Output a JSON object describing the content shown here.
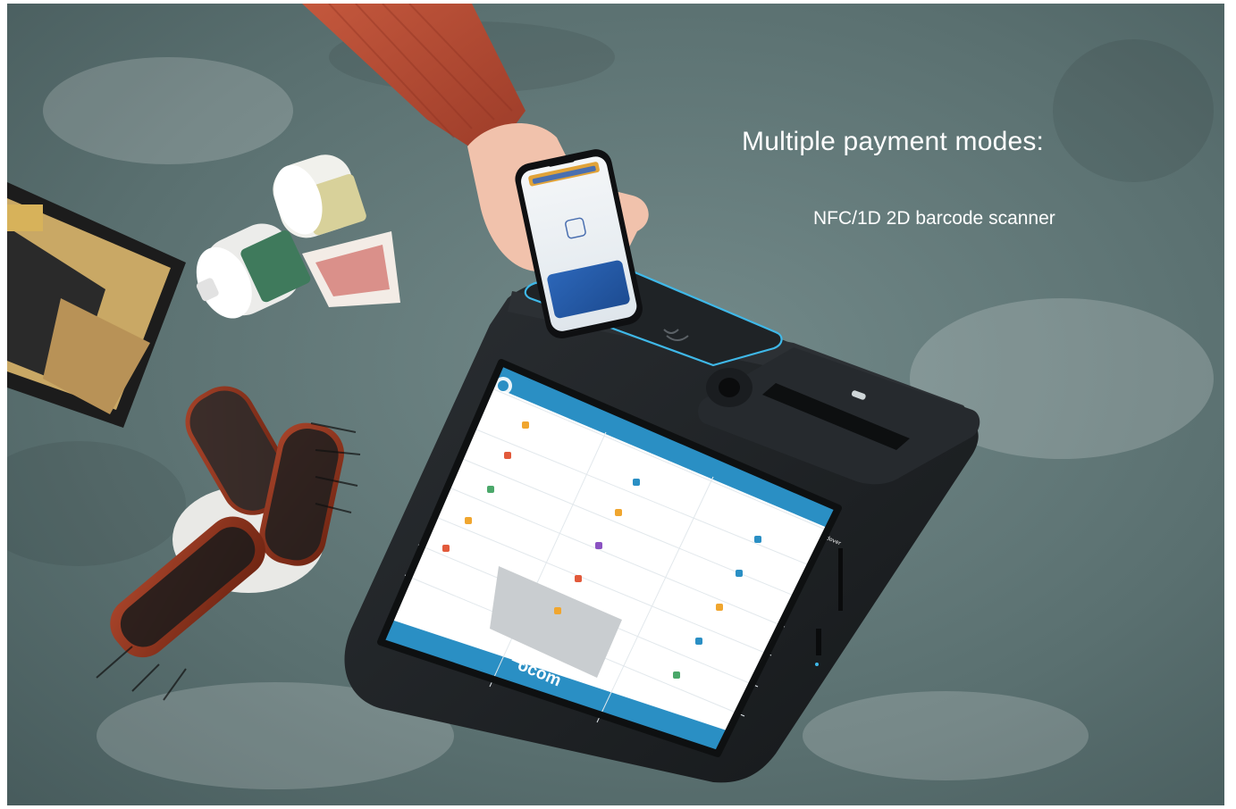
{
  "headline": "Multiple payment modes:",
  "subline": "NFC/1D 2D barcode scanner",
  "device": {
    "brand": "ocom",
    "screen_button": "Handover"
  },
  "colors": {
    "floor": "#5c7272",
    "device_body": "#1e2124",
    "screen_accent": "#2a8fc4",
    "nfc_glow": "#3fb8e8",
    "sleeve": "#b54a33",
    "text": "#ffffff"
  }
}
